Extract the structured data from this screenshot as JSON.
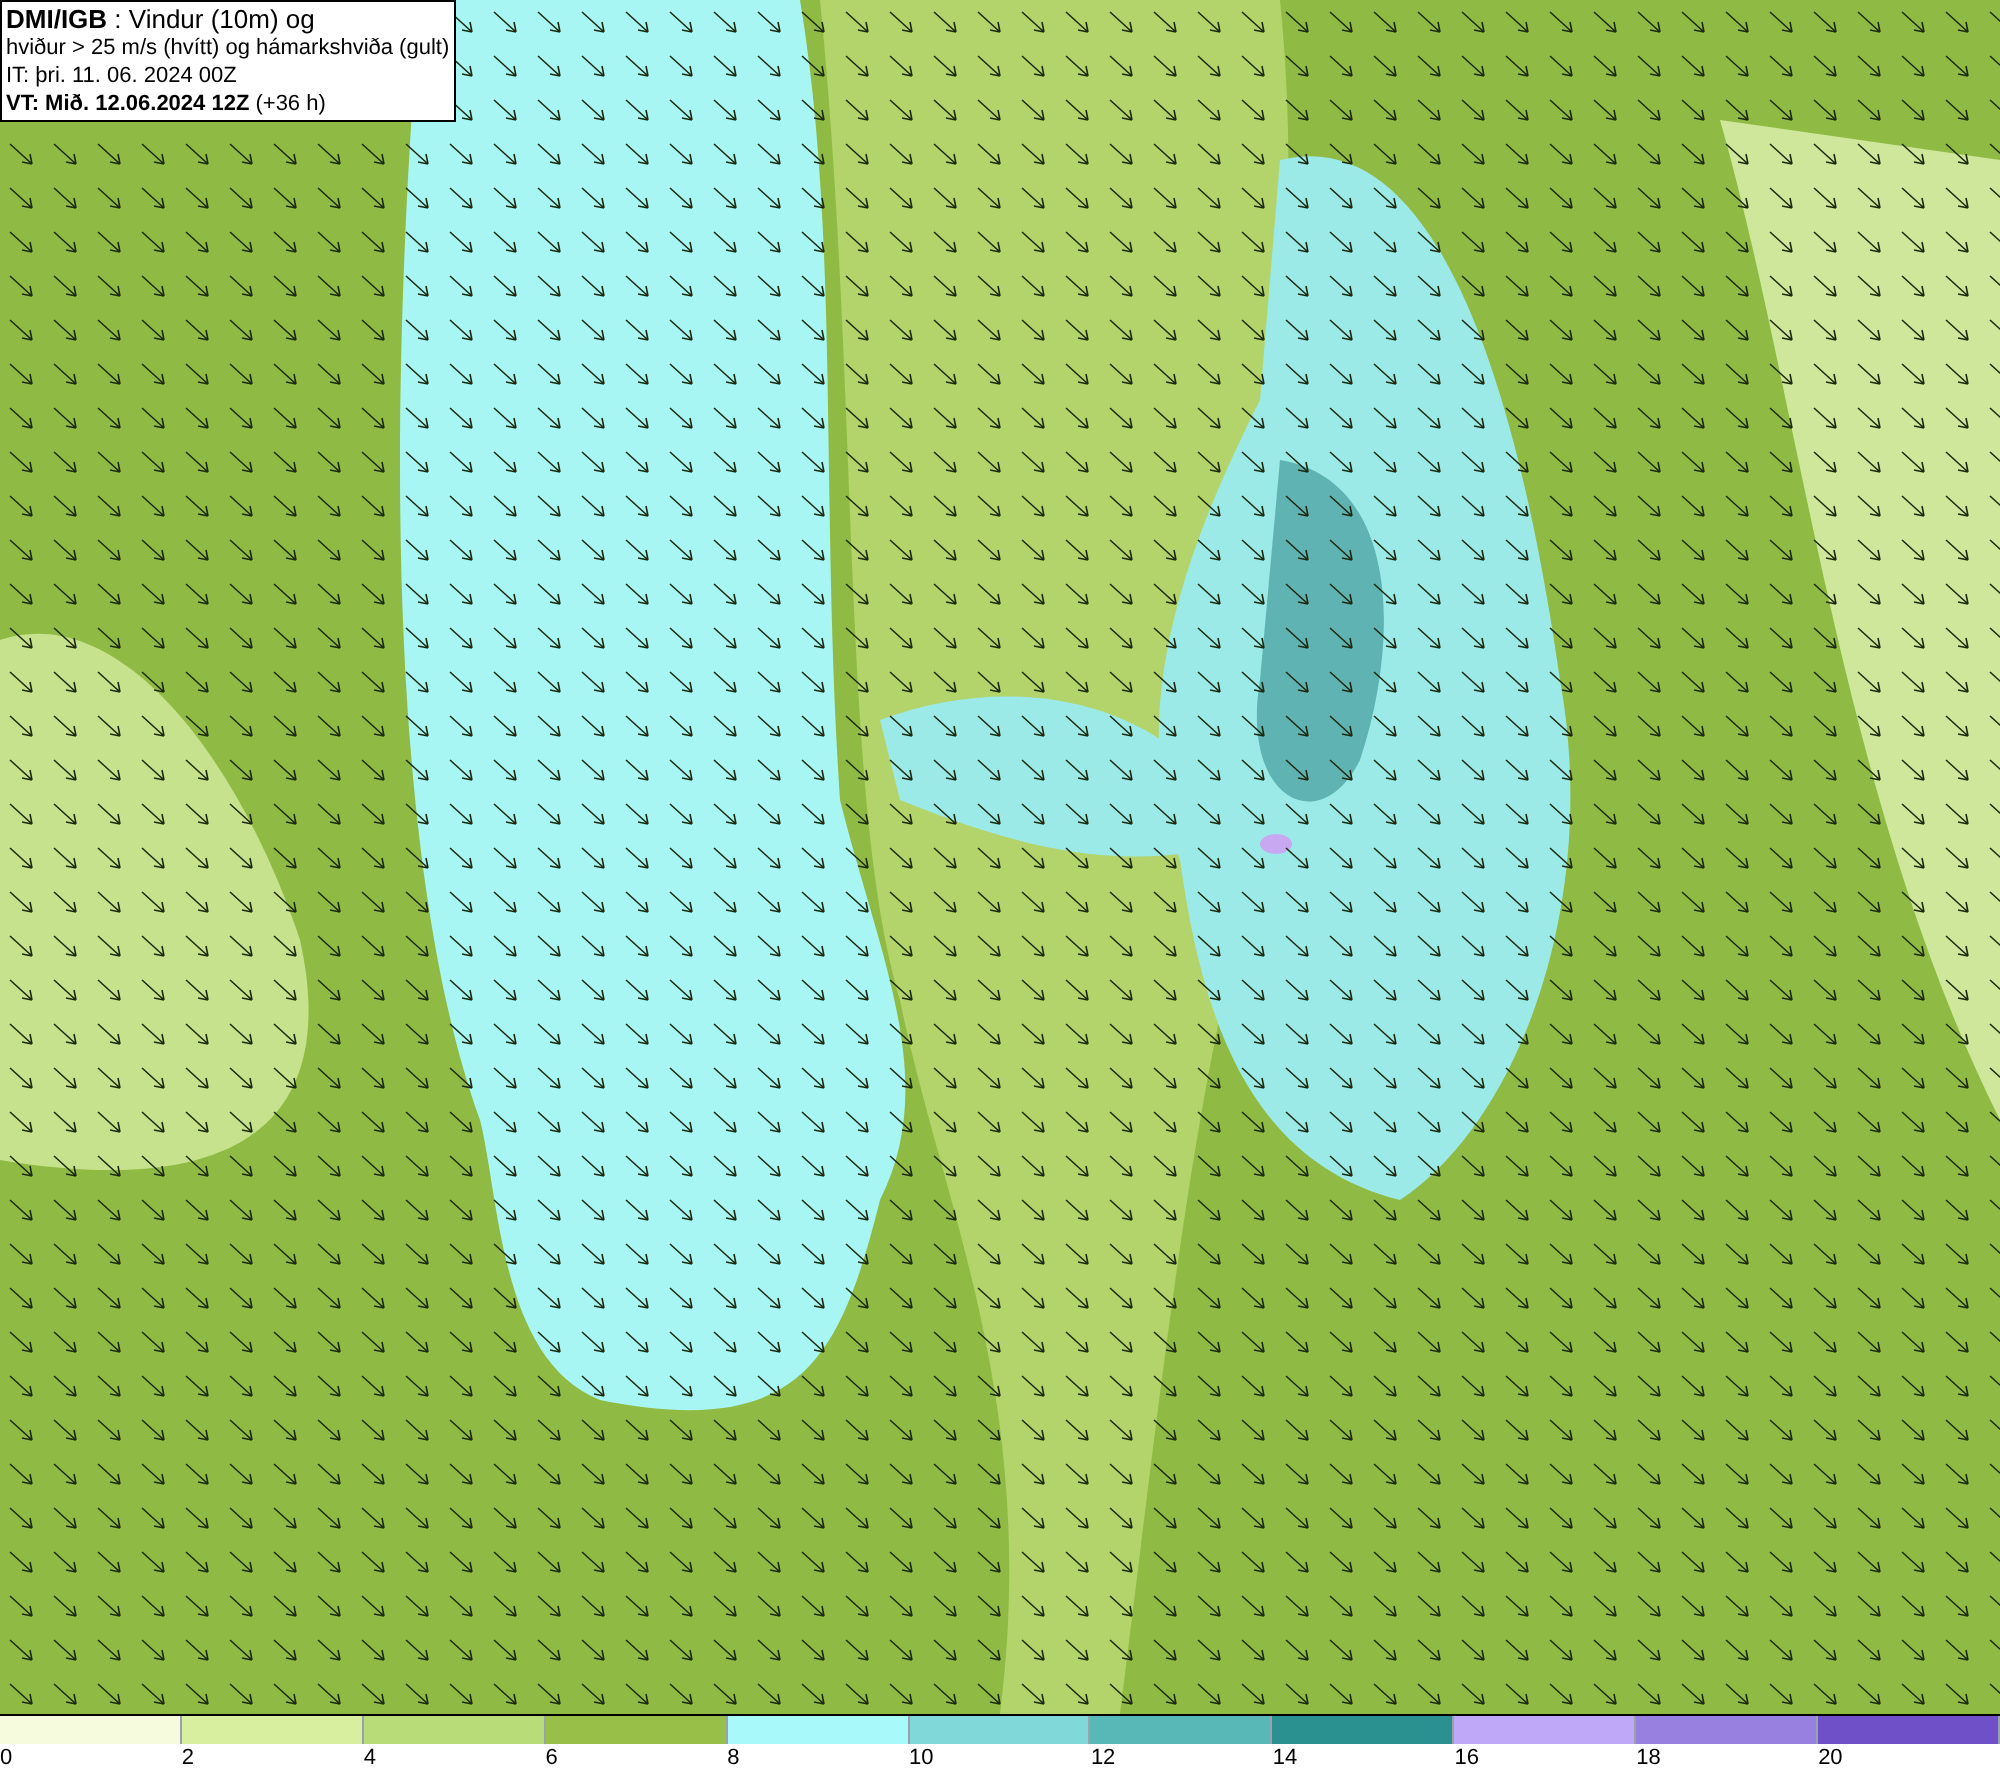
{
  "info_box": {
    "lines": [
      "**DMI/IGB** : Vindur (10m) og",
      "hviður > 25 m/s (hvítt) og hámarkshviða (gult)",
      "IT: þri. 11. 06. 2024 00Z",
      "**VT: Mið. 12.06.2024 12Z** (+36 h)"
    ]
  },
  "legend": [
    {
      "label": "0",
      "color": "#f5fbdc"
    },
    {
      "label": "2",
      "color": "#d9efa0"
    },
    {
      "label": "4",
      "color": "#b8dc78"
    },
    {
      "label": "6",
      "color": "#98c048"
    },
    {
      "label": "8",
      "color": "#a8fafa"
    },
    {
      "label": "10",
      "color": "#80d8d8"
    },
    {
      "label": "12",
      "color": "#58b8b8"
    },
    {
      "label": "14",
      "color": "#2a9090"
    },
    {
      "label": "16",
      "color": "#c0a8f8"
    },
    {
      "label": "18",
      "color": "#9880e0"
    },
    {
      "label": "20",
      "color": "#7050c8"
    }
  ]
}
